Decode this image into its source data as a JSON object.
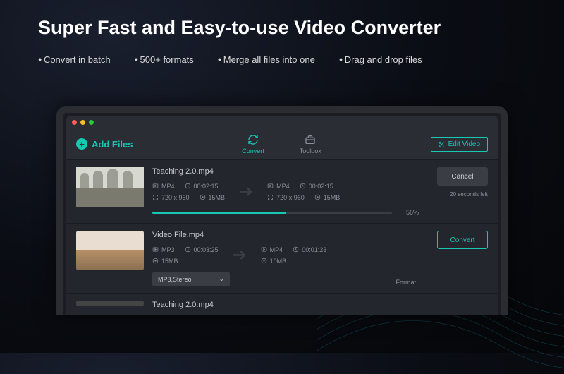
{
  "headline": "Super Fast and Easy-to-use Video Converter",
  "bullets": [
    "Convert in batch",
    "500+ formats",
    "Merge all files into one",
    "Drag and drop files"
  ],
  "toolbar": {
    "add_files": "Add Files",
    "convert_tab": "Convert",
    "toolbox_tab": "Toolbox",
    "edit_video": "Edit Video"
  },
  "buttons": {
    "cancel": "Cancel",
    "convert": "Convert"
  },
  "items": [
    {
      "filename": "Teaching 2.0.mp4",
      "src": {
        "format": "MP4",
        "duration": "00:02:15",
        "resolution": "720 x 960",
        "size": "15MB"
      },
      "dst": {
        "format": "MP4",
        "duration": "00:02:15",
        "resolution": "720 x 960",
        "size": "15MB"
      },
      "progress_pct": 56,
      "progress_text": "56%",
      "time_left": "20 seconds left",
      "state": "converting"
    },
    {
      "filename": "Video File.mp4",
      "src": {
        "format": "MP3",
        "duration": "00:03:25",
        "size": "15MB"
      },
      "dst": {
        "format": "MP4",
        "duration": "00:01:23",
        "size": "10MB"
      },
      "dropdown": "MP3,Stereo",
      "format_label": "Format",
      "state": "ready"
    },
    {
      "filename": "Teaching 2.0.mp4",
      "state": "collapsed"
    }
  ]
}
